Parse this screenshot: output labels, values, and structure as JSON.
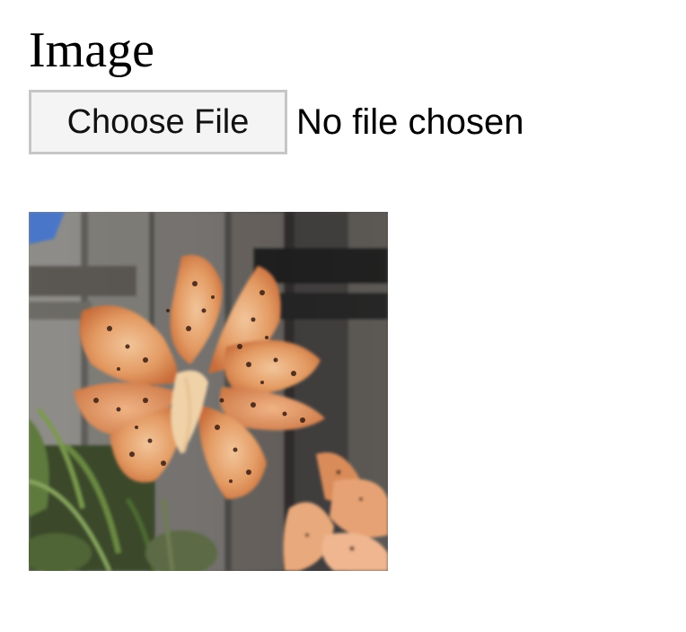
{
  "form": {
    "title": "Image",
    "file_input": {
      "button_label": "Choose File",
      "status_text": "No file chosen"
    }
  },
  "preview": {
    "subject": "orange spotted tiger lily flower in front of a grey wooden fence"
  }
}
